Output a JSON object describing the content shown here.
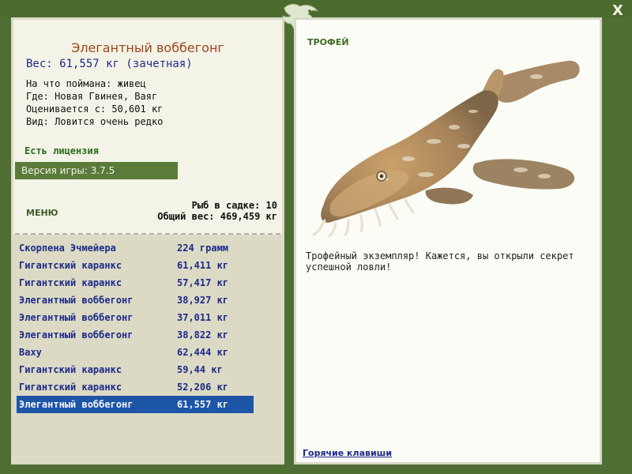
{
  "window": {
    "close_label": "X"
  },
  "fish": {
    "name": "Элегантный воббегонг",
    "weight_line": "Вес: 61,557 кг (зачетная)",
    "bait_line": "На что поймана: живец",
    "location_line": "Где: Новая Гвинея, Ваяг",
    "rated_line": "Оценивается с: 50,601 кг",
    "species_line": "Вид: Ловится очень редко"
  },
  "license": "Есть лицензия",
  "version": "Версия игры: 3.7.5",
  "menu_label": "МЕНЮ",
  "keepnet": {
    "count_line": "Рыб в садке: 10",
    "total_line": "Общий вес: 469,459 кг"
  },
  "catches": [
    {
      "name": "Скорпена Эчмейера",
      "weight": "224 грамм"
    },
    {
      "name": "Гигантский каранкс",
      "weight": "61,411 кг"
    },
    {
      "name": "Гигантский каранкс",
      "weight": "57,417 кг"
    },
    {
      "name": "Элегантный воббегонг",
      "weight": "38,927 кг"
    },
    {
      "name": "Элегантный воббегонг",
      "weight": "37,011 кг"
    },
    {
      "name": "Элегантный воббегонг",
      "weight": "38,822 кг"
    },
    {
      "name": "Ваху",
      "weight": "62,444 кг"
    },
    {
      "name": "Гигантский каранкс",
      "weight": "59,44 кг"
    },
    {
      "name": "Гигантский каранкс",
      "weight": "52,206 кг"
    },
    {
      "name": "Элегантный воббегонг",
      "weight": "61,557 кг"
    }
  ],
  "selected_catch_index": 9,
  "trophy_label": "ТРОФЕЙ",
  "trophy_text": "Трофейный экземпляр! Кажется, вы открыли секрет успешной ловли!",
  "hotkeys_label": "Горячие клавиши",
  "colors": {
    "frame": "#4f6e33",
    "panel": "#f4f3e7",
    "list_bg": "#dcdac4",
    "selection": "#1d56a6",
    "link": "#1c2a8a",
    "title": "#a0451a"
  }
}
